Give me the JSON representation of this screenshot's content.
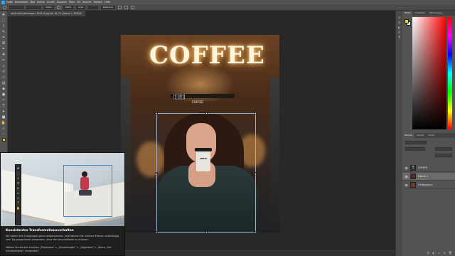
{
  "app": {
    "name": "Photoshop"
  },
  "menubar": {
    "items": [
      "Datei",
      "Bearbeiten",
      "Bild",
      "Ebene",
      "Schrift",
      "Auswahl",
      "Filter",
      "3D",
      "Ansicht",
      "Fenster",
      "Hilfe"
    ]
  },
  "options": {
    "w": "100%",
    "h": "100%",
    "angle": "0,00",
    "interp": "Bikubisch"
  },
  "document": {
    "tab_title": "adult-alley-beverage-1749310.jpg bei 16,7% (Ebene 1, RGB/8)"
  },
  "canvas": {
    "sign": "COFFEE",
    "small_sign": "COFFEE",
    "cup_label": "MEHR",
    "tooltip": "B: 1380 Px\nH: 1627 Px"
  },
  "panels": {
    "top_tabs": [
      "Farbe",
      "Farbfelder",
      "Bibliotheken"
    ],
    "layer_tabs": [
      "Ebenen",
      "Kanäle",
      "Pfade"
    ],
    "layers": [
      {
        "name": "COFFEE",
        "type": "T",
        "selected": false
      },
      {
        "name": "Ebene 1",
        "type": "",
        "selected": true
      },
      {
        "name": "Hintergrund",
        "type": "",
        "selected": false
      }
    ],
    "footer_icons": [
      "fx",
      "◐",
      "▭",
      "⊕",
      "🗑"
    ]
  },
  "tip": {
    "title": "Konsistentes Transformationsverhalten",
    "body1": "Wir haben Ihre Anregungen gerne aufgenommen, jetzt können Sie mehrere Ebenen unabhängig vom Typ proportional umwandeln, ohne die Umschalttaste zu drücken.",
    "body2": "Wählen Sie die alte Funktion „Photoshop“ > „Einstellungen“ > „Allgemein“ > „Ältere „Frei transformieren“ verwenden“"
  },
  "colors": {
    "accent": "#2fa3f7",
    "foreground": "#e0d22a",
    "background": "#ffffff",
    "selection": "#3d8bd6"
  },
  "tools": [
    "move",
    "marquee",
    "lasso",
    "quick-select",
    "crop",
    "frame",
    "eyedropper",
    "heal",
    "brush",
    "stamp",
    "history",
    "eraser",
    "gradient",
    "blur",
    "dodge",
    "pen",
    "type",
    "path-select",
    "shape",
    "hand",
    "zoom"
  ]
}
